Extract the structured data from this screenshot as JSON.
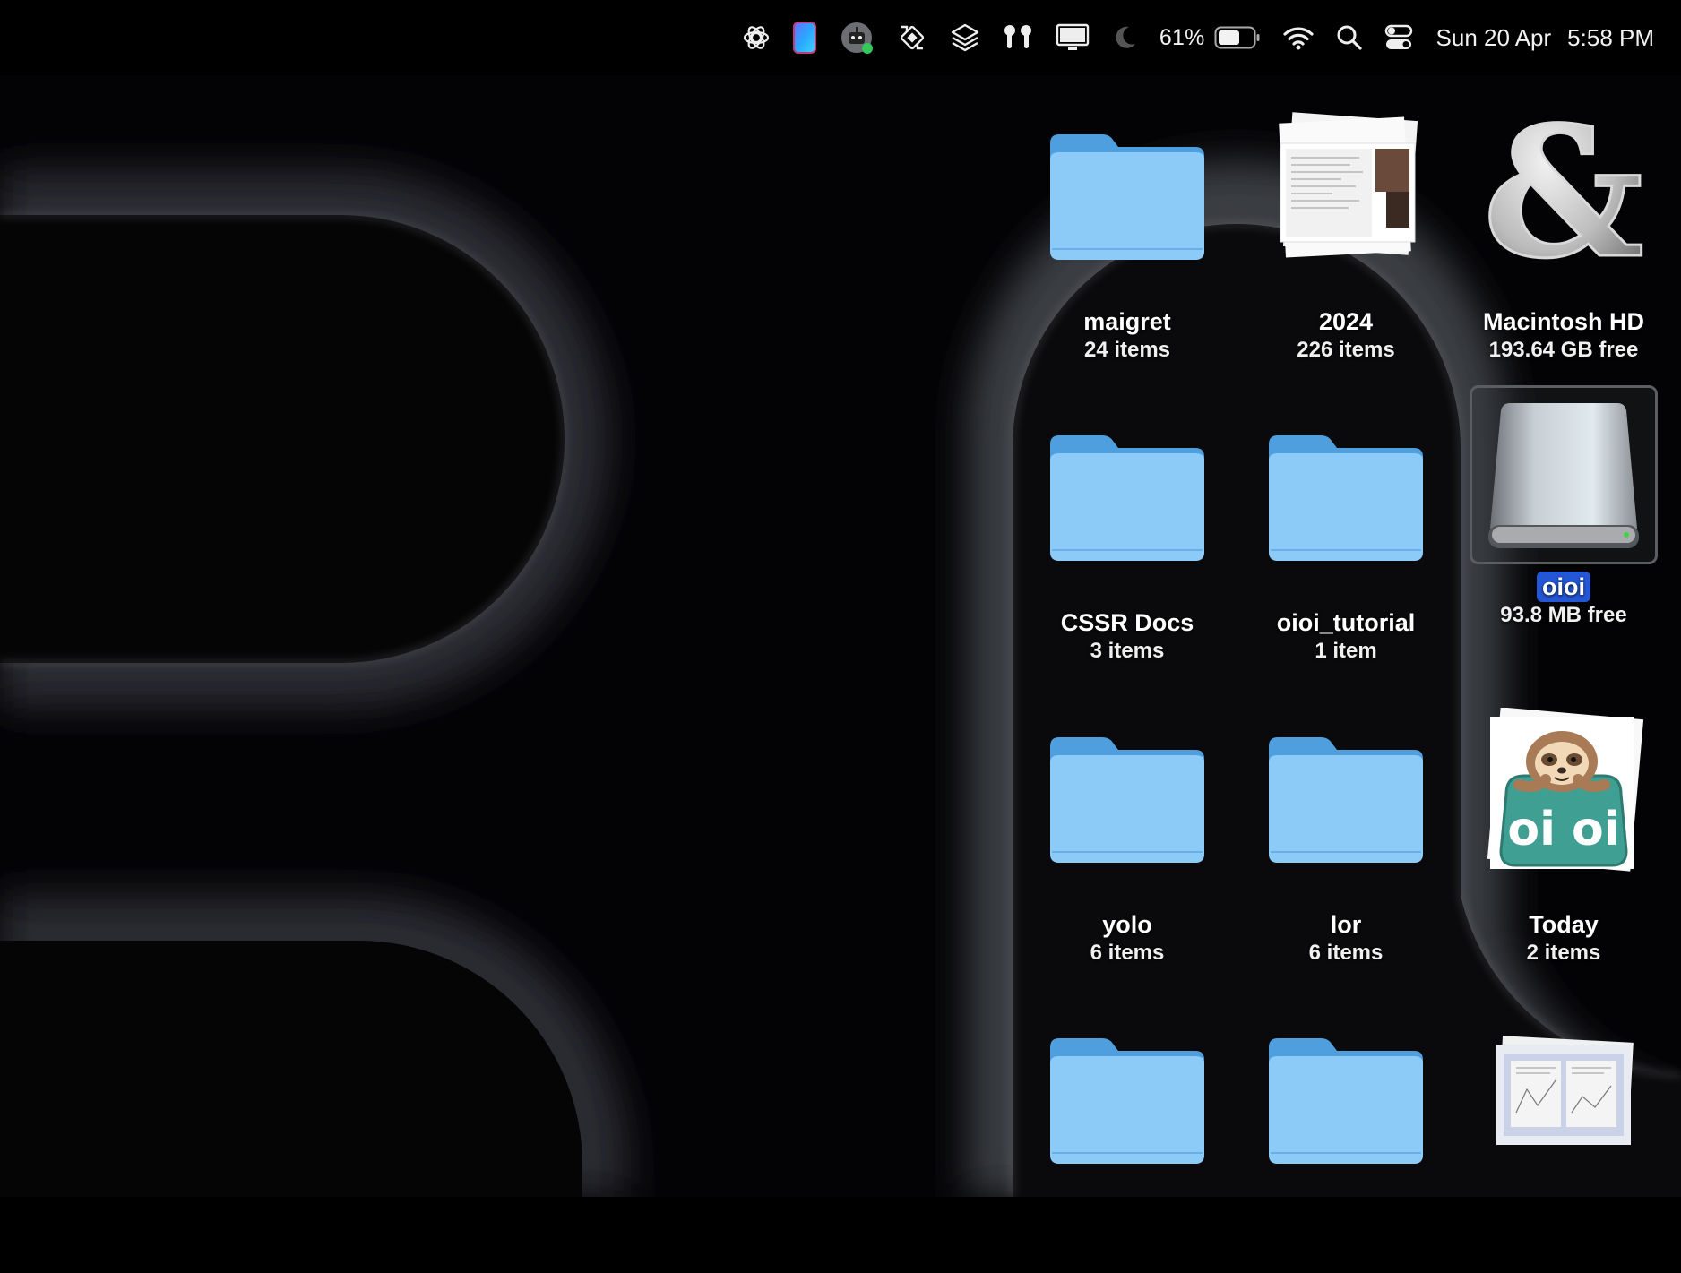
{
  "menubar": {
    "icons": [
      "chatgpt-icon",
      "color-picker-icon",
      "bot-app-icon",
      "display-rotate-icon",
      "layers-icon",
      "airpods-icon",
      "display-icon",
      "moon-icon"
    ],
    "battery_percent": "61%",
    "battery_level": 0.61,
    "date": "Sun 20 Apr",
    "time": "5:58 PM"
  },
  "desktop": {
    "items": [
      {
        "name": "maigret",
        "info": "24 items",
        "kind": "folder"
      },
      {
        "name": "2024",
        "info": "226 items",
        "kind": "stack"
      },
      {
        "name": "Macintosh HD",
        "info": "193.64 GB free",
        "kind": "disk-ampersand"
      },
      {
        "name": "CSSR Docs",
        "info": "3 items",
        "kind": "folder"
      },
      {
        "name": "oioi_tutorial",
        "info": "1 item",
        "kind": "folder"
      },
      {
        "name": "oioi",
        "info": "93.8 MB free",
        "kind": "external-drive",
        "selected": true
      },
      {
        "name": "yolo",
        "info": "6 items",
        "kind": "folder"
      },
      {
        "name": "lor",
        "info": "6 items",
        "kind": "folder"
      },
      {
        "name": "Today",
        "info": "2 items",
        "kind": "oioi-app"
      },
      {
        "name": "",
        "info": "",
        "kind": "folder"
      },
      {
        "name": "",
        "info": "",
        "kind": "folder"
      },
      {
        "name": "",
        "info": "",
        "kind": "stack-blue"
      }
    ]
  }
}
